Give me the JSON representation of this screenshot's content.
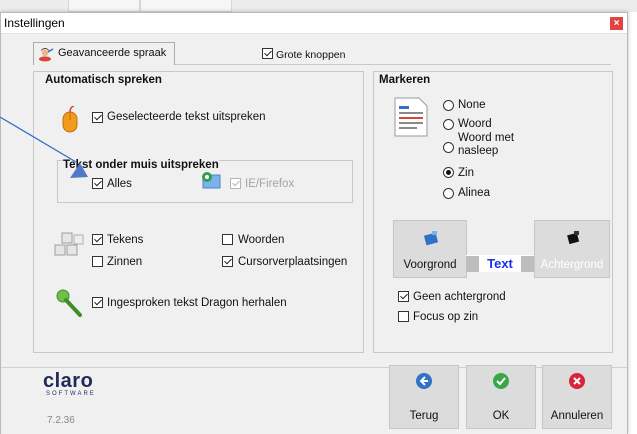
{
  "dialog": {
    "title": "Instellingen",
    "close_icon": "close-icon"
  },
  "tabs": {
    "active_label": "Geavanceerde spraak",
    "grote_knoppen": {
      "label": "Grote knoppen",
      "checked": true
    }
  },
  "auto_speak": {
    "title": "Automatisch spreken",
    "selected_text": {
      "label": "Geselecteerde tekst uitspreken",
      "checked": true
    },
    "mouse_group": {
      "title": "Tekst onder muis uitspreken",
      "alles": {
        "label": "Alles",
        "checked": true
      },
      "ie_firefox": {
        "label": "IE/Firefox",
        "checked": true,
        "disabled": true
      }
    },
    "tekens": {
      "label": "Tekens",
      "checked": true
    },
    "woorden": {
      "label": "Woorden",
      "checked": false
    },
    "zinnen": {
      "label": "Zinnen",
      "checked": false
    },
    "cursor": {
      "label": "Cursorverplaatsingen",
      "checked": true
    },
    "dragon": {
      "label": "Ingesproken tekst Dragon herhalen",
      "checked": true
    }
  },
  "markeren": {
    "title": "Markeren",
    "options": [
      "None",
      "Woord",
      "Woord met nasleep",
      "Zin",
      "Alinea"
    ],
    "selected": "Zin",
    "voorgrond_label": "Voorgrond",
    "achtergrond_label": "Achtergrond",
    "sample_text": "Text",
    "geen_achtergrond": {
      "label": "Geen achtergrond",
      "checked": true
    },
    "focus_op_zin": {
      "label": "Focus op zin",
      "checked": false
    }
  },
  "footer": {
    "brand": "claro",
    "brand_sub": "SOFTWARE",
    "version": "7.2.36",
    "terug": "Terug",
    "ok": "OK",
    "annuleren": "Annuleren"
  },
  "colors": {
    "accent_blue": "#2f72c8",
    "ok_green": "#3aa64a",
    "cancel_red": "#d7263b",
    "brand_navy": "#1f2a5a"
  }
}
